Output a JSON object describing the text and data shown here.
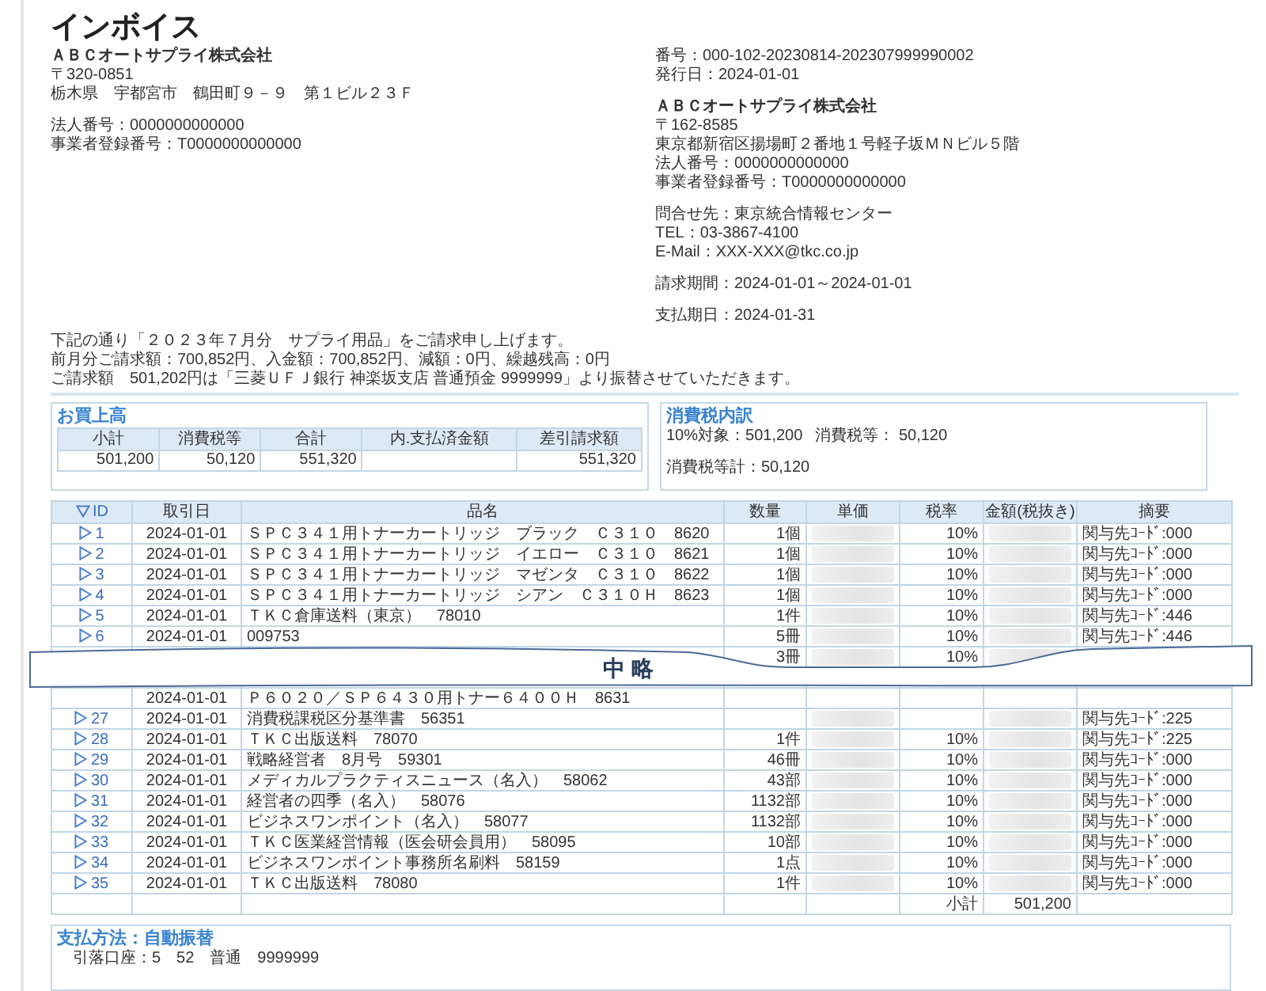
{
  "title": "インボイス",
  "issuer": {
    "name": "ＡＢＣオートサプライ株式会社",
    "postal": "〒320-0851",
    "address": "栃木県　宇都宮市　鶴田町９－９　第１ビル２３Ｆ",
    "corporate_number": "法人番号：0000000000000",
    "registration_number": "事業者登録番号：T0000000000000"
  },
  "document": {
    "number": "番号：000-102-20230814-202307999990002",
    "issue_date": "発行日：2024-01-01"
  },
  "recipient": {
    "name": "ＡＢＣオートサプライ株式会社",
    "postal": "〒162-8585",
    "address": "東京都新宿区揚場町２番地１号軽子坂ＭＮビル５階",
    "corporate_number": "法人番号：0000000000000",
    "registration_number": "事業者登録番号：T0000000000000"
  },
  "contact": {
    "name": "問合せ先：東京統合情報センター",
    "tel": "TEL：03-3867-4100",
    "email": "E-Mail：XXX-XXX@tkc.co.jp"
  },
  "billing_period": "請求期間：2024-01-01～2024-01-01",
  "due_date": "支払期日：2024-01-31",
  "message": [
    "下記の通り「２０２３年７月分　サプライ用品」をご請求申し上げます。",
    "前月分ご請求額：700,852円、入金額：700,852円、減額：0円、繰越残高：0円",
    "ご請求額　501,202円は「三菱ＵＦＪ銀行 神楽坂支店 普通預金 9999999」より振替させていただきます。"
  ],
  "purchase_summary": {
    "title": "お買上高",
    "cells": [
      {
        "heading": "小計",
        "value": "501,200"
      },
      {
        "heading": "消費税等",
        "value": "50,120"
      },
      {
        "heading": "合計",
        "value": "551,320"
      },
      {
        "heading": "内.支払済金額"
      },
      {
        "heading": "差引請求額",
        "value": "551,320"
      }
    ]
  },
  "tax_breakdown": {
    "title": "消費税内訳",
    "target": "10%対象：501,200",
    "tax": "消費税等： 50,120",
    "total": "消費税等計：50,120"
  },
  "table": {
    "columns": [
      "ID",
      "取引日",
      "品名",
      "数量",
      "単価",
      "税率",
      "金額(税抜き)",
      "摘要"
    ],
    "rows": [
      {
        "kind": "item",
        "id": "1",
        "date": "2024-01-01",
        "name": "ＳＰＣ３４１用トナーカートリッジ　ブラック　Ｃ３１０　8620",
        "qty": "1個",
        "rate": "10%",
        "memo": "関与先ｺｰﾄﾞ:000",
        "blurred": true
      },
      {
        "kind": "item",
        "id": "2",
        "date": "2024-01-01",
        "name": "ＳＰＣ３４１用トナーカートリッジ　イエロー　Ｃ３１０　8621",
        "qty": "1個",
        "rate": "10%",
        "memo": "関与先ｺｰﾄﾞ:000",
        "blurred": true
      },
      {
        "kind": "item",
        "id": "3",
        "date": "2024-01-01",
        "name": "ＳＰＣ３４１用トナーカートリッジ　マゼンタ　Ｃ３１０　8622",
        "qty": "1個",
        "rate": "10%",
        "memo": "関与先ｺｰﾄﾞ:000",
        "blurred": true
      },
      {
        "kind": "item",
        "id": "4",
        "date": "2024-01-01",
        "name": "ＳＰＣ３４１用トナーカートリッジ　シアン　Ｃ３１０Ｈ　8623",
        "qty": "1個",
        "rate": "10%",
        "memo": "関与先ｺｰﾄﾞ:000",
        "blurred": true
      },
      {
        "kind": "item",
        "id": "5",
        "date": "2024-01-01",
        "name": "ＴＫＣ倉庫送料（東京）　78010",
        "qty": "1件",
        "rate": "10%",
        "memo": "関与先ｺｰﾄﾞ:446",
        "blurred": true
      },
      {
        "kind": "item",
        "id": "6",
        "date": "2024-01-01",
        "name": "009753",
        "qty": "5冊",
        "rate": "10%",
        "memo": "関与先ｺｰﾄﾞ:446",
        "blurred": true
      },
      {
        "kind": "item",
        "qty": "3冊",
        "rate": "10%",
        "blurred": true
      },
      {
        "kind": "omission",
        "label": "中 略"
      },
      {
        "kind": "item",
        "date": "2024-01-01",
        "name": "Ｐ６０２０／ＳＰ６４３０用トナー６４００Ｈ　8631",
        "blurred": false
      },
      {
        "kind": "item",
        "id": "27",
        "date": "2024-01-01",
        "name": "消費税課税区分基準書　56351",
        "memo": "関与先ｺｰﾄﾞ:225",
        "blurred": true
      },
      {
        "kind": "item",
        "id": "28",
        "date": "2024-01-01",
        "name": "ＴＫＣ出版送料　78070",
        "qty": "1件",
        "rate": "10%",
        "memo": "関与先ｺｰﾄﾞ:225",
        "blurred": true
      },
      {
        "kind": "item",
        "id": "29",
        "date": "2024-01-01",
        "name": "戦略経営者　8月号　59301",
        "qty": "46冊",
        "rate": "10%",
        "memo": "関与先ｺｰﾄﾞ:000",
        "blurred": true
      },
      {
        "kind": "item",
        "id": "30",
        "date": "2024-01-01",
        "name": "メディカルプラクティスニュース（名入）　58062",
        "qty": "43部",
        "rate": "10%",
        "memo": "関与先ｺｰﾄﾞ:000",
        "blurred": true
      },
      {
        "kind": "item",
        "id": "31",
        "date": "2024-01-01",
        "name": "経営者の四季（名入）　58076",
        "qty": "1132部",
        "rate": "10%",
        "memo": "関与先ｺｰﾄﾞ:000",
        "blurred": true
      },
      {
        "kind": "item",
        "id": "32",
        "date": "2024-01-01",
        "name": "ビジネスワンポイント（名入）　58077",
        "qty": "1132部",
        "rate": "10%",
        "memo": "関与先ｺｰﾄﾞ:000",
        "blurred": true
      },
      {
        "kind": "item",
        "id": "33",
        "date": "2024-01-01",
        "name": "ＴＫＣ医業経営情報（医会研会員用）　58095",
        "qty": "10部",
        "rate": "10%",
        "memo": "関与先ｺｰﾄﾞ:000",
        "blurred": true
      },
      {
        "kind": "item",
        "id": "34",
        "date": "2024-01-01",
        "name": "ビジネスワンポイント事務所名刷料　58159",
        "qty": "1点",
        "rate": "10%",
        "memo": "関与先ｺｰﾄﾞ:000",
        "blurred": true
      },
      {
        "kind": "item",
        "id": "35",
        "date": "2024-01-01",
        "name": "ＴＫＣ出版送料　78080",
        "qty": "1件",
        "rate": "10%",
        "memo": "関与先ｺｰﾄﾞ:000",
        "blurred": true
      }
    ],
    "subtotal": {
      "label": "小計",
      "value": "501,200"
    }
  },
  "payment": {
    "title": "支払方法：自動振替",
    "account": "引落口座：5　52　普通　9999999"
  }
}
